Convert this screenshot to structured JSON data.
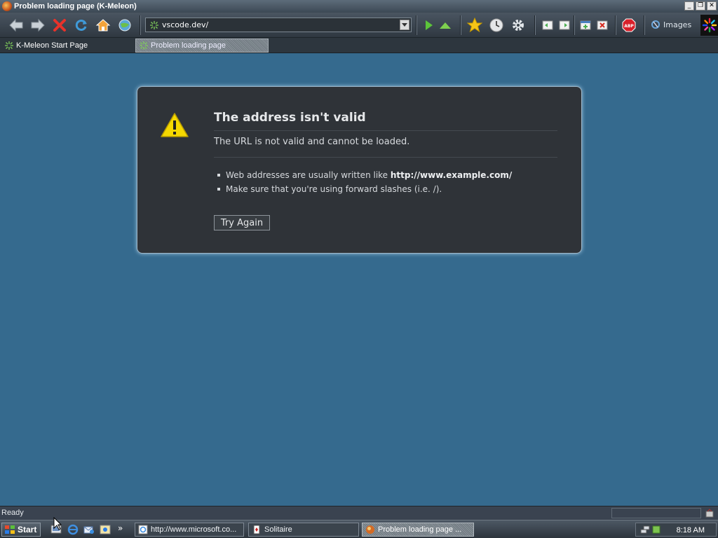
{
  "window": {
    "title": "Problem loading page (K-Meleon)",
    "controls": [
      "minimize",
      "restore",
      "close"
    ]
  },
  "toolbar": {
    "buttons": [
      {
        "name": "back-icon"
      },
      {
        "name": "forward-icon"
      },
      {
        "name": "stop-icon"
      },
      {
        "name": "reload-icon"
      },
      {
        "name": "home-icon"
      },
      {
        "name": "globe-icon"
      },
      {
        "name": "go-icon"
      },
      {
        "name": "up-icon"
      },
      {
        "name": "bookmark-star-icon"
      },
      {
        "name": "history-clock-icon"
      },
      {
        "name": "settings-gear-icon"
      },
      {
        "name": "adblock-icon"
      }
    ],
    "url_value": "vscode.dev/",
    "images_label": "Images"
  },
  "tabs": [
    {
      "label": "K-Meleon Start Page",
      "active": false
    },
    {
      "label": "Problem loading page",
      "active": true
    }
  ],
  "error": {
    "title": "The address isn't valid",
    "description": "The URL is not valid and cannot be loaded.",
    "bullet1_prefix": "Web addresses are usually written like ",
    "bullet1_bold": "http://www.example.com/",
    "bullet2": "Make sure that you're using forward slashes (i.e. /).",
    "button": "Try Again"
  },
  "status": {
    "text": "Ready"
  },
  "taskbar": {
    "start_label": "Start",
    "more_label": "»",
    "tasks": [
      {
        "label": "http://www.microsoft.co...",
        "active": false
      },
      {
        "label": "Solitaire",
        "active": false
      },
      {
        "label": "Problem loading page ...",
        "active": true
      }
    ],
    "clock": "8:18 AM"
  },
  "colors": {
    "page_bg": "#356a8e",
    "panel_bg": "#2f3338",
    "warning": "#f5d800"
  }
}
